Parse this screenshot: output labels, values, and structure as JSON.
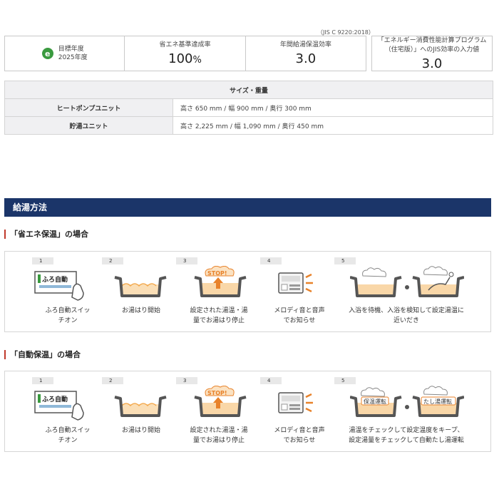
{
  "standard_note": "（JIS C 9220:2018）",
  "performance": {
    "target_icon": "e",
    "target_label_1": "目標年度",
    "target_label_2": "2025年度",
    "achievement_label": "省エネ基準達成率",
    "achievement_value": "100",
    "achievement_unit": "%",
    "efficiency_label": "年間給湯保温効率",
    "efficiency_value": "3.0",
    "program_label_1": "「エネルギー消費性能計算プログラム",
    "program_label_2": "（住宅版）」へのJIS効率の入力値",
    "program_value": "3.0"
  },
  "spec": {
    "title": "サイズ・重量",
    "rows": [
      {
        "label": "ヒートポンプユニット",
        "value": "高さ 650 mm / 幅 900 mm / 奥行 300 mm"
      },
      {
        "label": "貯湯ユニット",
        "value": "高さ 2,225 mm / 幅 1,090 mm / 奥行 450 mm"
      }
    ]
  },
  "section_title": "給湯方法",
  "modes": [
    {
      "title": "「省エネ保温」の場合",
      "steps": [
        {
          "num": "1",
          "icon": "panel-switch-icon",
          "panel_text": "ふろ自動",
          "caption_1": "ふろ自動スイッ",
          "caption_2": "チオン"
        },
        {
          "num": "2",
          "icon": "bath-filling-icon",
          "caption_1": "お湯はり開始",
          "caption_2": ""
        },
        {
          "num": "3",
          "icon": "bath-stop-icon",
          "stop_text": "STOP!",
          "caption_1": "設定された湯温・湯",
          "caption_2": "量でお湯はり停止"
        },
        {
          "num": "4",
          "icon": "remote-sound-icon",
          "caption_1": "メロディ音と音声",
          "caption_2": "でお知らせ"
        },
        {
          "num": "5",
          "icon": "bath-person-icon",
          "caption_1": "入浴を待機、入浴を検知して設定湯温に",
          "caption_2": "近いだき"
        }
      ]
    },
    {
      "title": "「自動保温」の場合",
      "steps": [
        {
          "num": "1",
          "icon": "panel-switch-icon",
          "panel_text": "ふろ自動",
          "caption_1": "ふろ自動スイッ",
          "caption_2": "チオン"
        },
        {
          "num": "2",
          "icon": "bath-filling-icon",
          "caption_1": "お湯はり開始",
          "caption_2": ""
        },
        {
          "num": "3",
          "icon": "bath-stop-icon",
          "stop_text": "STOP!",
          "caption_1": "設定された湯温・湯",
          "caption_2": "量でお湯はり停止"
        },
        {
          "num": "4",
          "icon": "remote-sound-icon",
          "caption_1": "メロディ音と音声",
          "caption_2": "でお知らせ"
        },
        {
          "num": "5",
          "icon": "bath-keep-warm-icon",
          "label_a": "保温運転",
          "label_b": "たし湯運転",
          "caption_1": "湯温をチェックして設定温度をキープ、",
          "caption_2": "設定湯量をチェックして自動たし湯運転"
        }
      ]
    }
  ],
  "colors": {
    "accent_bar": "#1b3569",
    "water": "#f6c27a",
    "stop": "#e8822a"
  }
}
